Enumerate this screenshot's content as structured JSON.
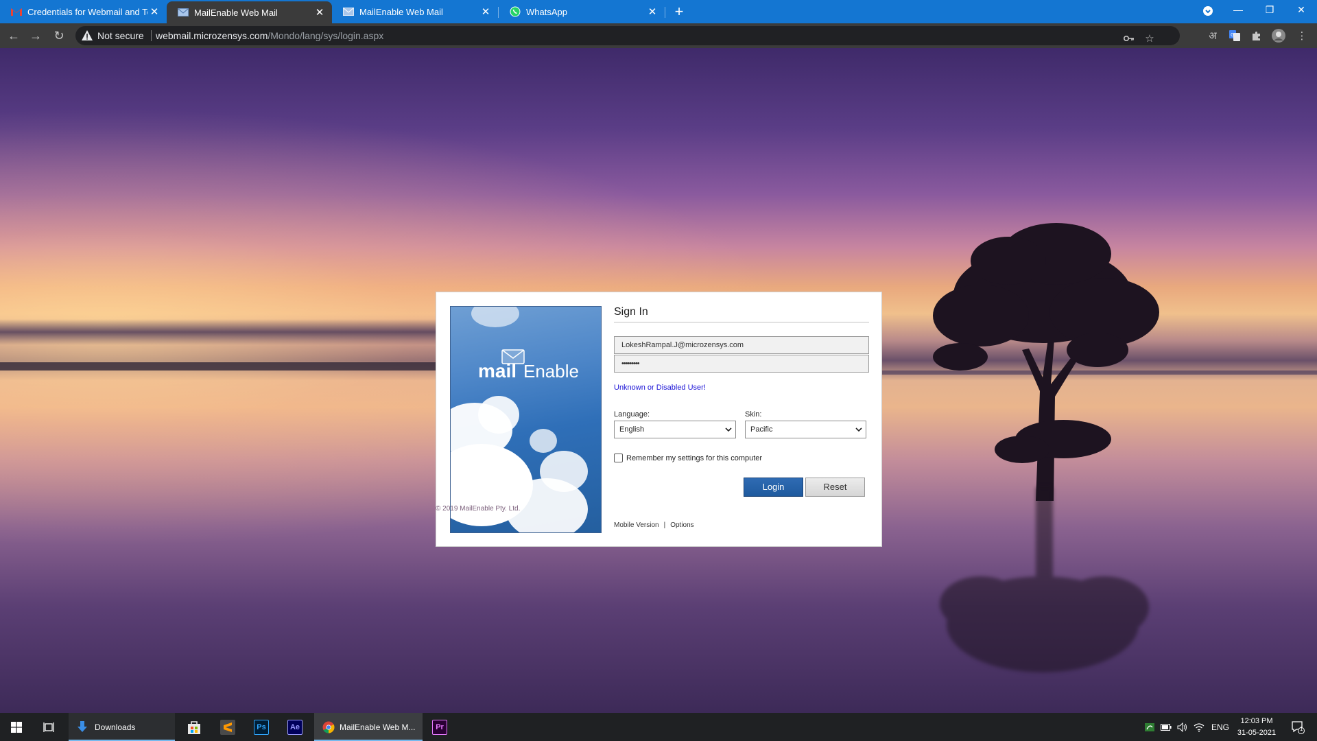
{
  "browser": {
    "tabs": [
      {
        "title": "Credentials for Webmail and Tea",
        "icon": "gmail-icon",
        "active": false
      },
      {
        "title": "MailEnable Web Mail",
        "icon": "mail-icon",
        "active": true
      },
      {
        "title": "MailEnable Web Mail",
        "icon": "mail-icon",
        "active": false
      },
      {
        "title": "WhatsApp",
        "icon": "whatsapp-icon",
        "active": false
      }
    ],
    "security_label": "Not secure",
    "url_host": "webmail.microzensys.com",
    "url_path": "/Mondo/lang/sys/login.aspx",
    "translate_glyph": "अ",
    "accent_color": "#1476d2"
  },
  "login": {
    "logo_word_1": "mail",
    "logo_word_2": "Enable",
    "heading": "Sign In",
    "username_value": "LokeshRampal.J@microzensys.com",
    "password_value": "•••••••••",
    "error_message": "Unknown or Disabled User!",
    "language_label": "Language:",
    "language_value": "English",
    "skin_label": "Skin:",
    "skin_value": "Pacific",
    "remember_label": "Remember my settings for this computer",
    "remember_checked": false,
    "login_button": "Login",
    "reset_button": "Reset",
    "mobile_link": "Mobile Version",
    "link_separator": "|",
    "options_link": "Options",
    "copyright": "© 2019 MailEnable Pty. Ltd."
  },
  "taskbar": {
    "downloads_label": "Downloads",
    "active_window_label": "MailEnable Web M...",
    "ps_label": "Ps",
    "ae_label": "Ae",
    "pr_label": "Pr",
    "language": "ENG",
    "time": "12:03 PM",
    "date": "31-05-2021",
    "notification_count": "1"
  }
}
